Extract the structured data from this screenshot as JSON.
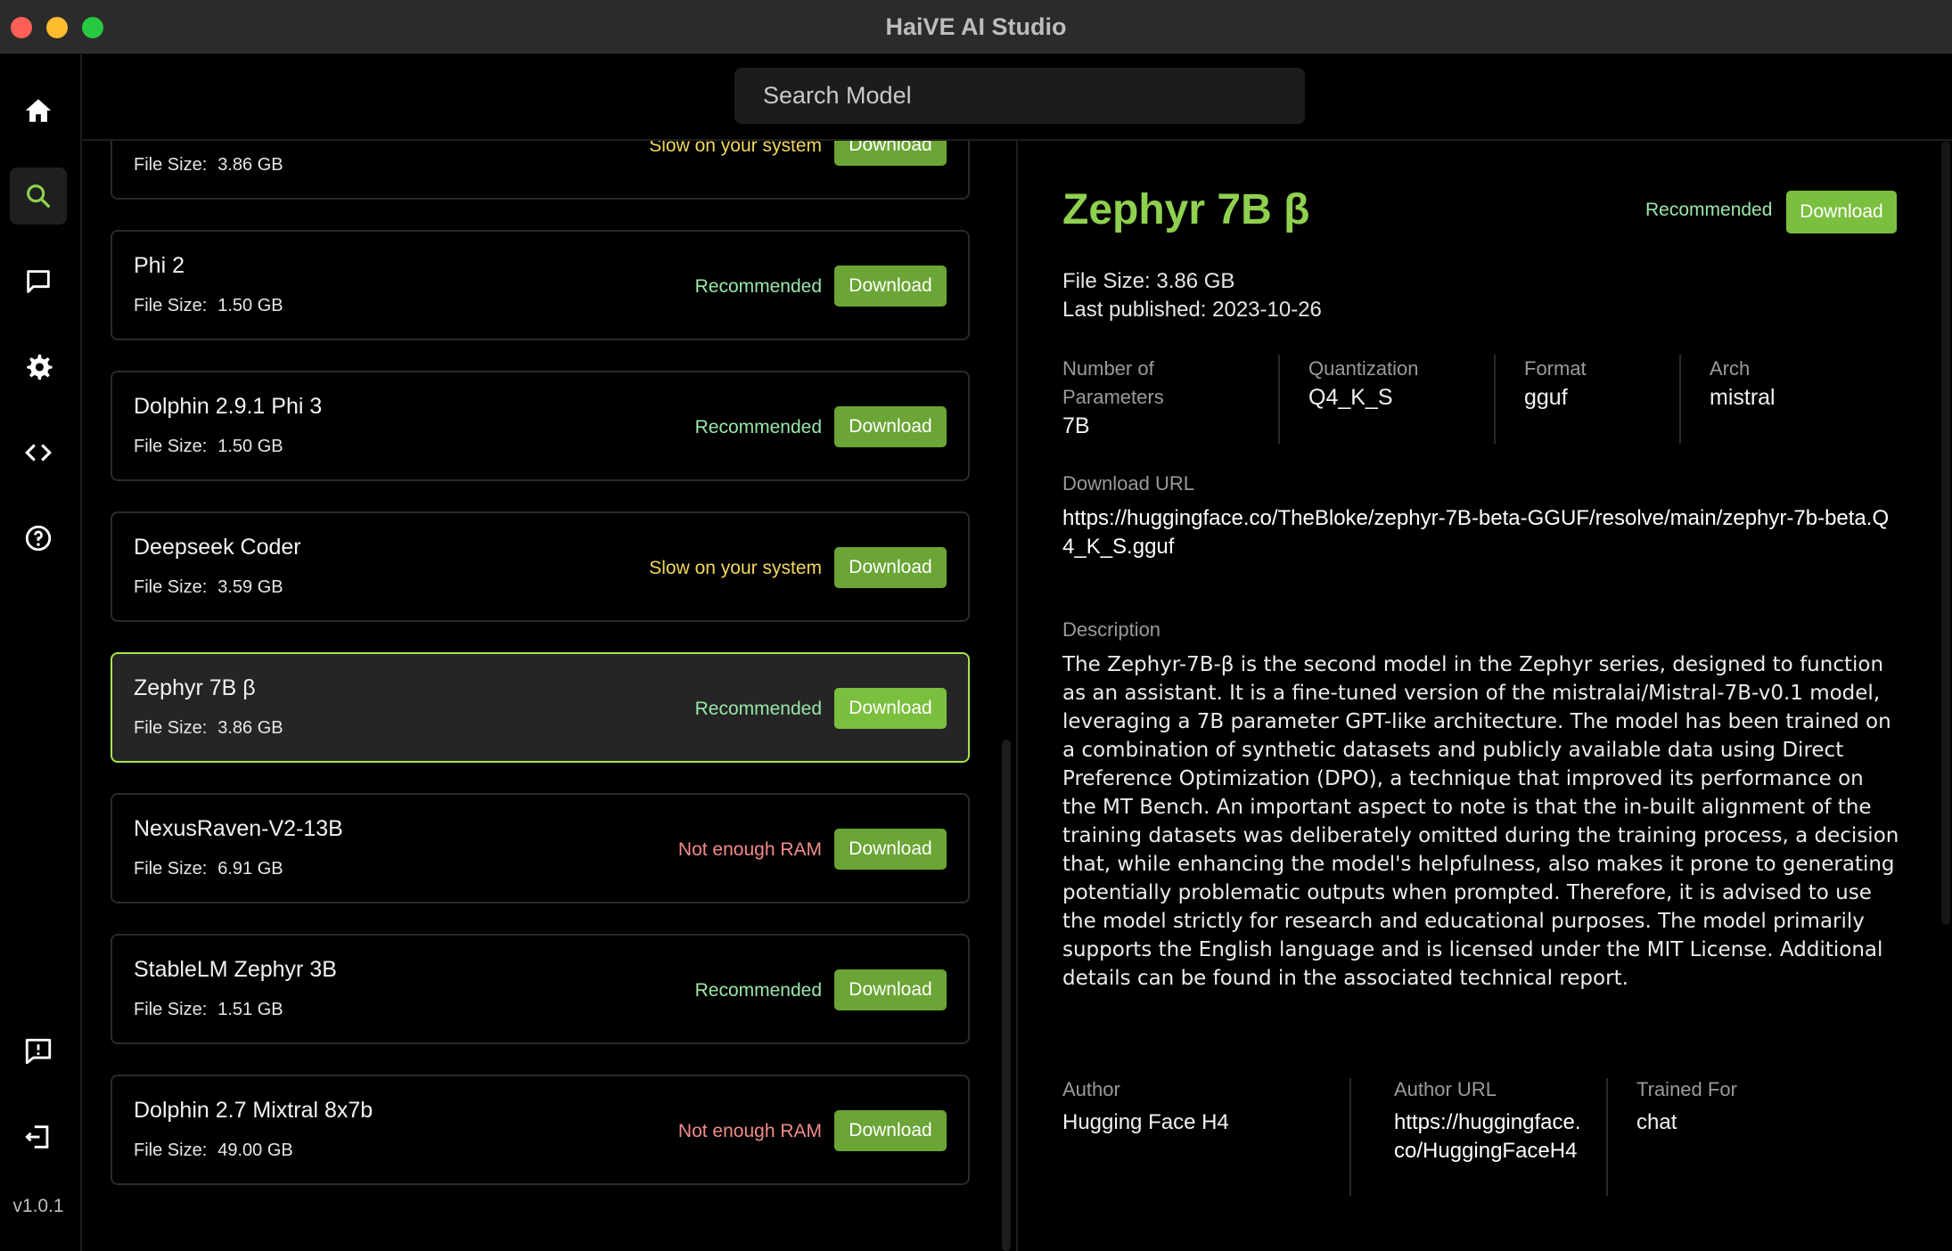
{
  "window": {
    "title": "HaiVE AI Studio"
  },
  "sidebar": {
    "items": [
      {
        "icon": "home-icon"
      },
      {
        "icon": "search-icon",
        "active": true
      },
      {
        "icon": "chat-icon"
      },
      {
        "icon": "gear-icon"
      },
      {
        "icon": "code-icon"
      },
      {
        "icon": "help-icon"
      },
      {
        "icon": "feedback-icon"
      },
      {
        "icon": "logout-icon"
      }
    ],
    "version": "v1.0.1"
  },
  "search": {
    "placeholder": "Search Model"
  },
  "list": {
    "size_label": "File Size:",
    "download_label": "Download",
    "models": [
      {
        "name": "",
        "size": "3.86 GB",
        "status": "Slow on your system",
        "status_type": "slow"
      },
      {
        "name": "Phi 2",
        "size": "1.50 GB",
        "status": "Recommended",
        "status_type": "rec"
      },
      {
        "name": "Dolphin 2.9.1 Phi 3",
        "size": "1.50 GB",
        "status": "Recommended",
        "status_type": "rec"
      },
      {
        "name": "Deepseek Coder",
        "size": "3.59 GB",
        "status": "Slow on your system",
        "status_type": "slow"
      },
      {
        "name": "Zephyr 7B β",
        "size": "3.86 GB",
        "status": "Recommended",
        "status_type": "rec",
        "selected": true
      },
      {
        "name": "NexusRaven-V2-13B",
        "size": "6.91 GB",
        "status": "Not enough RAM",
        "status_type": "noram"
      },
      {
        "name": "StableLM Zephyr 3B",
        "size": "1.51 GB",
        "status": "Recommended",
        "status_type": "rec"
      },
      {
        "name": "Dolphin 2.7 Mixtral 8x7b",
        "size": "49.00 GB",
        "status": "Not enough RAM",
        "status_type": "noram"
      }
    ]
  },
  "detail": {
    "title": "Zephyr 7B β",
    "status": "Recommended",
    "download_label": "Download",
    "file_size": "File Size: 3.86 GB",
    "published": "Last published: 2023-10-26",
    "params_label": "Number of Parameters",
    "params_value": "7B",
    "quant_label": "Quantization",
    "quant_value": "Q4_K_S",
    "format_label": "Format",
    "format_value": "gguf",
    "arch_label": "Arch",
    "arch_value": "mistral",
    "url_label": "Download URL",
    "url_value": "https://huggingface.co/TheBloke/zephyr-7B-beta-GGUF/resolve/main/zephyr-7b-beta.Q4_K_S.gguf",
    "desc_label": "Description",
    "desc_value": "The Zephyr-7B-β is the second model in the Zephyr series, designed to function as an assistant. It is a fine-tuned version of the mistralai/Mistral-7B-v0.1 model, leveraging a 7B parameter GPT-like architecture. The model has been trained on a combination of synthetic datasets and publicly available data using Direct Preference Optimization (DPO), a technique that improved its performance on the MT Bench. An important aspect to note is that the in-built alignment of the training datasets was deliberately omitted during the training process, a decision that, while enhancing the model's helpfulness, also makes it prone to generating potentially problematic outputs when prompted. Therefore, it is advised to use the model strictly for research and educational purposes. The model primarily supports the English language and is licensed under the MIT License. Additional details can be found in the associated technical report.",
    "author_label": "Author",
    "author_value": "Hugging Face H4",
    "author_url_label": "Author URL",
    "author_url_value": "https://huggingface.co/HuggingFaceH4",
    "trained_label": "Trained For",
    "trained_value": "chat"
  },
  "colors": {
    "accent": "#7bbf3e",
    "title_green": "#8fd14f",
    "recommended": "#9ae6a8",
    "slow": "#f2d75c",
    "not_enough_ram": "#f28b8b"
  }
}
